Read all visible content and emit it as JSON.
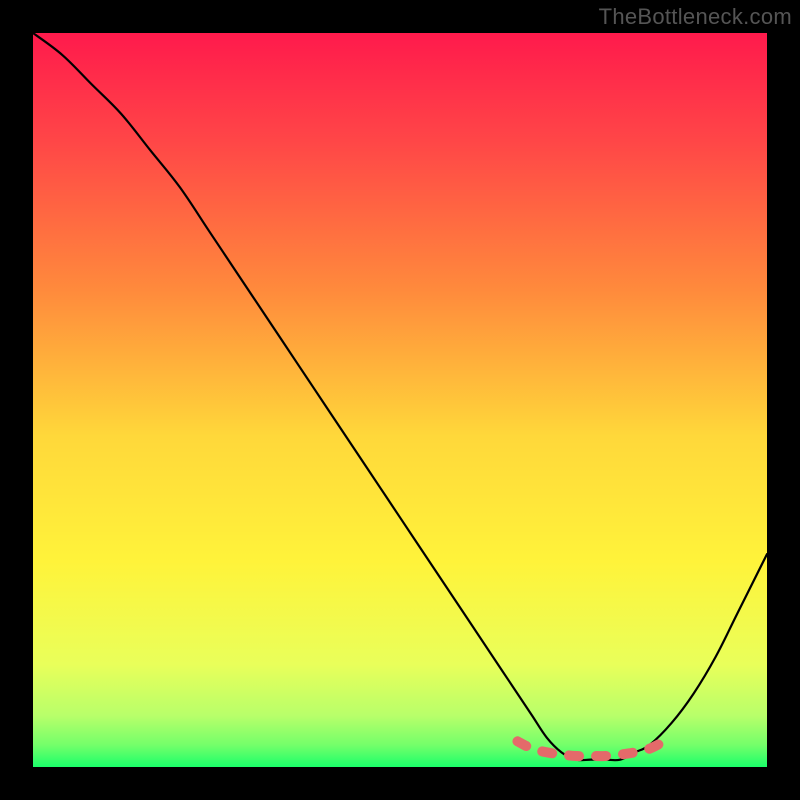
{
  "watermark": "TheBottleneck.com",
  "chart_data": {
    "type": "line",
    "title": "",
    "xlabel": "",
    "ylabel": "",
    "xlim": [
      0,
      100
    ],
    "ylim": [
      0,
      100
    ],
    "grid": false,
    "series": [
      {
        "name": "bottleneck-curve",
        "x": [
          0,
          4,
          8,
          12,
          16,
          20,
          24,
          28,
          32,
          36,
          40,
          44,
          48,
          52,
          56,
          60,
          64,
          66,
          68,
          70,
          72,
          74,
          76,
          78,
          80,
          82,
          84,
          87,
          90,
          93,
          96,
          100
        ],
        "values": [
          100,
          97,
          93,
          89,
          84,
          79,
          73,
          67,
          61,
          55,
          49,
          43,
          37,
          31,
          25,
          19,
          13,
          10,
          7,
          4,
          2,
          1,
          1,
          1,
          1,
          2,
          3,
          6,
          10,
          15,
          21,
          29
        ]
      },
      {
        "name": "optimal-range-marker",
        "x": [
          66,
          68,
          70,
          72,
          74,
          76,
          78,
          80,
          82,
          84,
          86
        ],
        "values": [
          3.5,
          2.5,
          2,
          1.7,
          1.5,
          1.5,
          1.5,
          1.7,
          2,
          2.5,
          3.5
        ]
      }
    ],
    "gradient_stops": [
      {
        "offset": 0,
        "color": "#ff1a4c"
      },
      {
        "offset": 15,
        "color": "#ff4747"
      },
      {
        "offset": 35,
        "color": "#ff8a3c"
      },
      {
        "offset": 55,
        "color": "#ffd83a"
      },
      {
        "offset": 72,
        "color": "#fff33a"
      },
      {
        "offset": 86,
        "color": "#e9ff5a"
      },
      {
        "offset": 93,
        "color": "#b8ff6a"
      },
      {
        "offset": 97,
        "color": "#74ff6a"
      },
      {
        "offset": 100,
        "color": "#1bff6a"
      }
    ]
  }
}
